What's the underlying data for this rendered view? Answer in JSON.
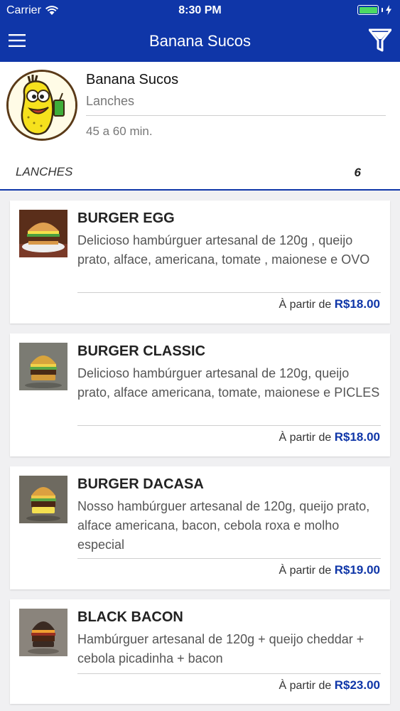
{
  "status_bar": {
    "carrier": "Carrier",
    "time": "8:30 PM"
  },
  "nav": {
    "title": "Banana Sucos",
    "menu_icon": "hamburger-menu-icon",
    "filter_icon": "filter-funnel-icon"
  },
  "restaurant": {
    "name": "Banana Sucos",
    "category": "Lanches",
    "delivery_time": "45 a 60 min."
  },
  "section": {
    "label": "LANCHES",
    "count": "6"
  },
  "products": [
    {
      "name": "BURGER EGG",
      "description": "Delicioso hambúrguer artesanal de 120g , queijo prato, alface, americana, tomate , maionese e OVO",
      "price_prefix": "À partir de",
      "price": "R$18.00"
    },
    {
      "name": "BURGER CLASSIC",
      "description": "Delicioso hambúrguer artesanal de 120g, queijo prato, alface americana, tomate, maionese e PICLES",
      "price_prefix": "À partir de",
      "price": "R$18.00"
    },
    {
      "name": "BURGER DACASA",
      "description": "Nosso hambúrguer artesanal de 120g, queijo prato, alface americana, bacon, cebola roxa e molho especial",
      "price_prefix": "À partir de",
      "price": "R$19.00"
    },
    {
      "name": "BLACK BACON",
      "description": "Hambúrguer artesanal de 120g + queijo cheddar + cebola picadinha + bacon",
      "price_prefix": "À partir de",
      "price": "R$23.00"
    }
  ],
  "colors": {
    "brand_blue": "#0f36a8",
    "battery_green": "#4cd964"
  }
}
